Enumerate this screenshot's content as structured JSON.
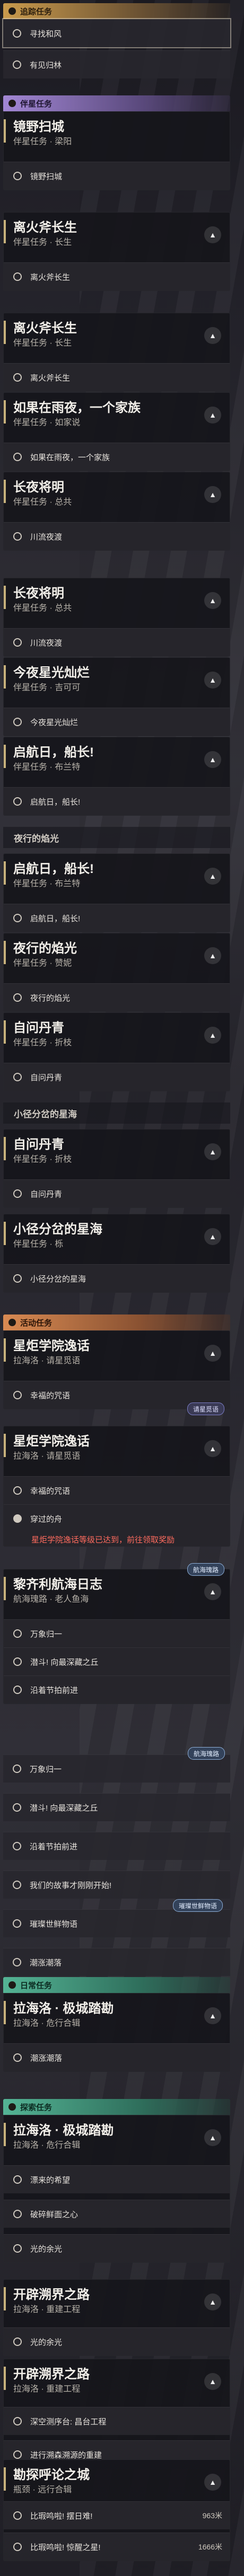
{
  "sections": {
    "tracking": "追踪任务",
    "companion": "伴星任务",
    "event": "活动任务",
    "daily": "日常任务",
    "exploration": "探索任务"
  },
  "track": {
    "obj1": "寻找和风",
    "obj2": "有见归林"
  },
  "c1": {
    "title": "镜野扫城",
    "sub": "伴星任务 · 梁阳",
    "obj": "镜野扫城"
  },
  "c2": {
    "title": "离火斧长生",
    "sub": "伴星任务 · 长生",
    "obj": "离火斧长生"
  },
  "c3": {
    "title": "离火斧长生",
    "sub": "伴星任务 · 长生",
    "obj": "离火斧长生"
  },
  "c4": {
    "title": "如果在雨夜，一个家族",
    "sub": "伴星任务 · 如家说",
    "obj": "如果在雨夜，一个家族"
  },
  "c5": {
    "title": "长夜将明",
    "sub": "伴星任务 · 总共",
    "obj": "川流夜渡"
  },
  "c6": {
    "title": "长夜将明",
    "sub": "伴星任务 · 总共",
    "obj": "川流夜渡"
  },
  "c7": {
    "title": "今夜星光灿烂",
    "sub": "伴星任务 · 吉可可",
    "obj": "今夜星光灿烂"
  },
  "c8": {
    "title": "启航日，船长!",
    "sub": "伴星任务 · 布兰特",
    "obj": "启航日，船长!"
  },
  "dim1": "夜行的焰光",
  "c9": {
    "title": "启航日，船长!",
    "sub": "伴星任务 · 布兰特",
    "obj": "启航日，船长!"
  },
  "c10": {
    "title": "夜行的焰光",
    "sub": "伴星任务 · 赞妮",
    "obj": "夜行的焰光"
  },
  "c11": {
    "title": "自问丹青",
    "sub": "伴星任务 · 折枝",
    "obj": "自问丹青"
  },
  "dim2": "小径分岔的星海",
  "c12": {
    "title": "自问丹青",
    "sub": "伴星任务 · 折枝",
    "obj": "自问丹青"
  },
  "c13": {
    "title": "小径分岔的星海",
    "sub": "伴星任务 · 栎",
    "obj": "小径分岔的星海"
  },
  "e1": {
    "title": "星炬学院逸话",
    "sub": "拉海洛 · 请星觅语",
    "obj": "幸福的咒语",
    "badge": "请星觅语"
  },
  "e2": {
    "title": "星炬学院逸话",
    "sub": "拉海洛 · 请星觅语",
    "obj1": "幸福的咒语",
    "obj2": "穿过的舟",
    "badge": "请星觅语",
    "warn": "星炬学院逸话等级已达到，前往领取奖励"
  },
  "e3": {
    "title": "黎齐利航海日志",
    "sub": "航海瑰路 · 老人鱼海",
    "obj1": "万象归一",
    "obj2": "潜斗! 向最深藏之丘",
    "obj3": "沿着节拍前进",
    "badge": "航海瑰路"
  },
  "e4": {
    "badge": "航海瑰路",
    "obj1": "万象归一",
    "obj2": "潜斗! 向最深藏之丘",
    "obj3": "沿着节拍前进",
    "obj4": "我们的故事才刚刚开始!",
    "obj5": "璀璨世鲜物语",
    "obj6": "潮涨潮落",
    "badge2": "璀璨世鲜物语"
  },
  "d1": {
    "title": "拉海洛 · 极城踏勘",
    "sub": "拉海洛 · 危行合辑",
    "obj": "潮涨潮落"
  },
  "d2": {
    "title": "拉海洛 · 极城踏勘",
    "sub": "拉海洛 · 危行合辑",
    "obj1": "漂来的希望",
    "obj2": "破碎鲜面之心",
    "obj3": "光的余光"
  },
  "x1": {
    "title": "开辟溯界之路",
    "sub": "拉海洛 · 重建工程",
    "obj": "光的余光"
  },
  "x2": {
    "title": "开辟溯界之路",
    "sub": "拉海洛 · 重建工程",
    "obj1": "深空测序台: 昌台工程",
    "obj2": "进行溯森溯源的重建"
  },
  "x3": {
    "title": "勘探呼论之城",
    "sub": "瓶颈 · 远行合辑",
    "obj1": "比瑕鸣啦! 摆日难!",
    "obj2": "比瑕鸣啦! 惊醒之星!",
    "dist": "1666米",
    "dist2": "963米"
  }
}
